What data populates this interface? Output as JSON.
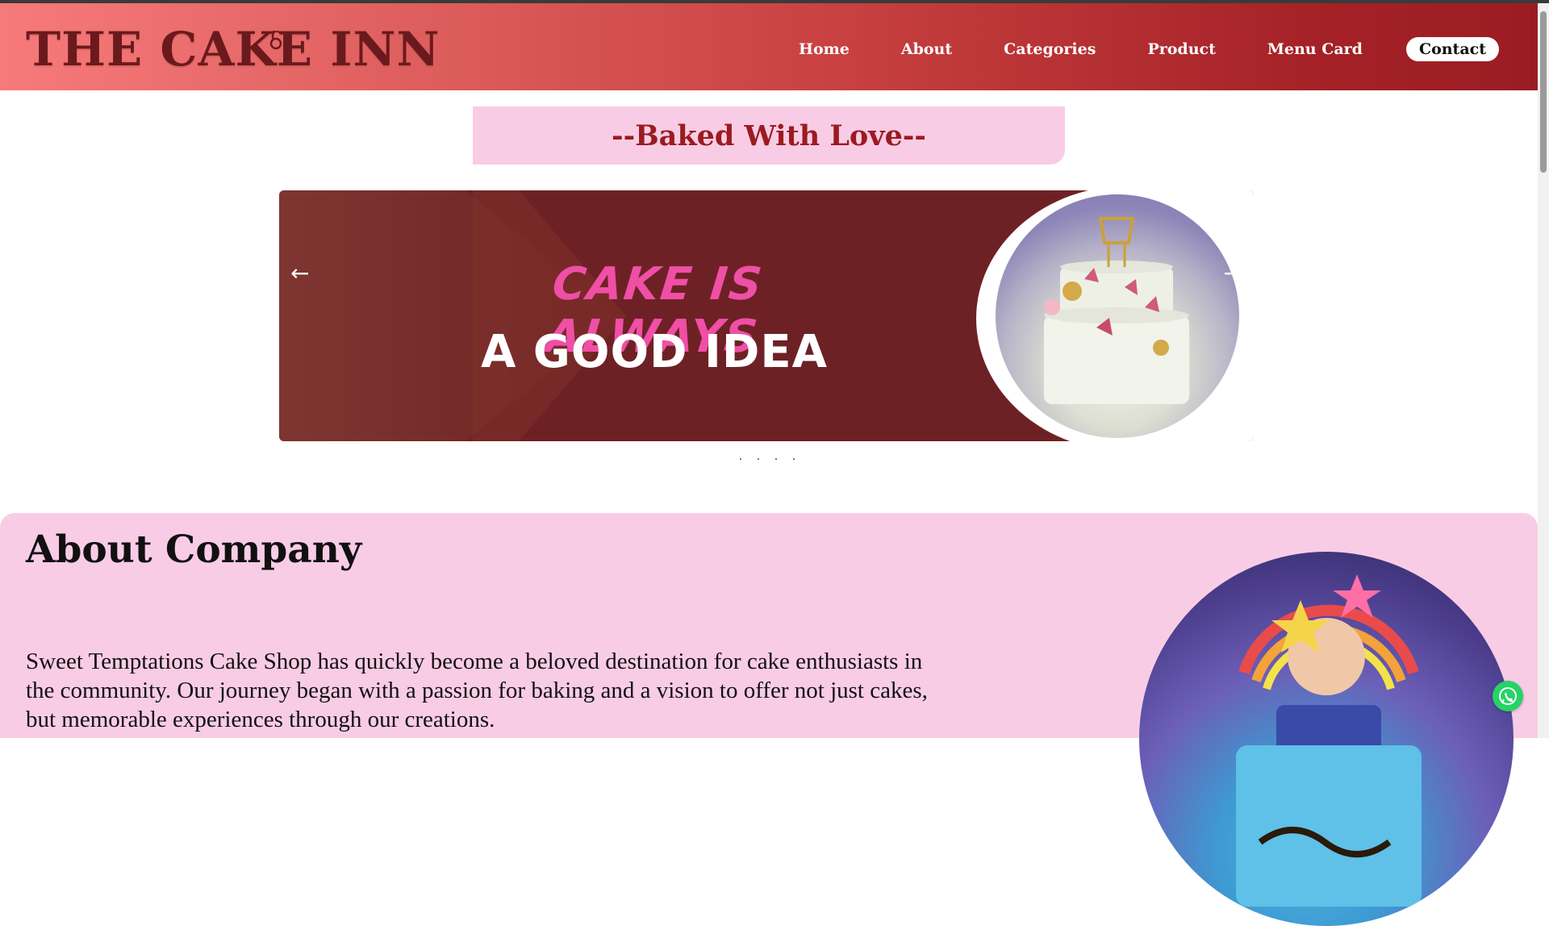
{
  "header": {
    "logo_text": "THE CAKE INN",
    "nav": [
      {
        "label": "Home"
      },
      {
        "label": "About"
      },
      {
        "label": "Categories"
      },
      {
        "label": "Product"
      },
      {
        "label": "Menu Card"
      },
      {
        "label": "Contact"
      }
    ]
  },
  "tagline": "--Baked With Love--",
  "slider": {
    "line1": "CAKE IS ALWAYS",
    "line2": "A GOOD IDEA",
    "prev_icon": "←",
    "next_icon": "→",
    "dots": [
      ".",
      ".",
      ".",
      "."
    ]
  },
  "about": {
    "title": "About Company",
    "text": "Sweet Temptations Cake Shop has quickly become a beloved destination for cake enthusiasts in the community. Our journey began with a passion for baking and a vision to offer not just cakes, but memorable experiences through our creations."
  },
  "colors": {
    "header_start": "#f77a7a",
    "header_end": "#9a1c22",
    "accent_pink": "#f9cce6",
    "brand_red": "#9b1b1f",
    "slider_bg": "#6e2124",
    "slide_pink": "#ef4fa6"
  },
  "icons": {
    "whatsapp": "whatsapp-icon"
  }
}
